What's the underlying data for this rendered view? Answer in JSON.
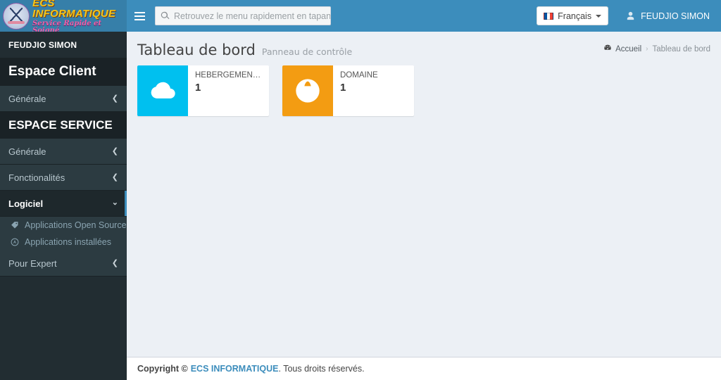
{
  "brand": {
    "title": "ECS INFORMATIQUE",
    "tagline": "Service Rapide et Soigné",
    "logo_icon": "ecs-circular-emblem"
  },
  "navbar": {
    "menu_toggle_icon": "hamburger-icon",
    "search": {
      "icon": "search-icon",
      "placeholder": "Retrouvez le menu rapidement en tapant ici",
      "value": ""
    },
    "language": {
      "label": "Français",
      "flag_icon": "flag-fr-icon",
      "caret_icon": "caret-down-icon"
    },
    "user": {
      "name": "FEUDJIO SIMON",
      "icon": "user-icon"
    }
  },
  "sidebar": {
    "user_panel": {
      "name": "FEUDJIO SIMON"
    },
    "sections": [
      {
        "header": "Espace Client",
        "style": "big",
        "items": [
          {
            "label": "Générale",
            "chevron": "chevron-left-icon",
            "active": false
          }
        ]
      },
      {
        "header": "ESPACE SERVICE",
        "style": "caps",
        "items": [
          {
            "label": "Générale",
            "chevron": "chevron-left-icon",
            "active": false
          },
          {
            "label": "Fonctionalités",
            "chevron": "chevron-left-icon",
            "active": false
          },
          {
            "label": "Logiciel",
            "chevron": "chevron-down-icon",
            "active": true
          },
          {
            "label": "Pour Expert",
            "chevron": "chevron-left-icon",
            "active": false
          }
        ]
      }
    ],
    "logiciel_subitems": [
      {
        "label": "Applications Open Source",
        "icon": "tag-icon"
      },
      {
        "label": "Applications installées",
        "icon": "circled-a-icon"
      }
    ]
  },
  "content": {
    "page_title": "Tableau de bord",
    "page_subtitle": "Panneau de contrôle",
    "breadcrumb": {
      "home_icon": "dashboard-icon",
      "home_label": "Accueil",
      "separator": "›",
      "current_label": "Tableau de bord"
    },
    "info_boxes": [
      {
        "text": "HÉBERGEMENT/…",
        "number": "1",
        "icon": "cloud-icon",
        "color": "#00c0ef"
      },
      {
        "text": "DOMAINE",
        "number": "1",
        "icon": "globe-icon",
        "color": "#f39c12"
      }
    ]
  },
  "footer": {
    "copyright_prefix": "Copyright ©",
    "company_link": "ECS INFORMATIQUE",
    "rights": ". Tous droits réservés."
  },
  "colors": {
    "navbar": "#3c8dbc",
    "logo_bg": "#367fa9",
    "sidebar": "#222d32",
    "sidebar_header": "#1a2226",
    "sidebar_item": "#2c3b41",
    "content_bg": "#ecf0f5",
    "accent_cyan": "#00c0ef",
    "accent_orange": "#f39c12",
    "link": "#3c8dbc"
  }
}
